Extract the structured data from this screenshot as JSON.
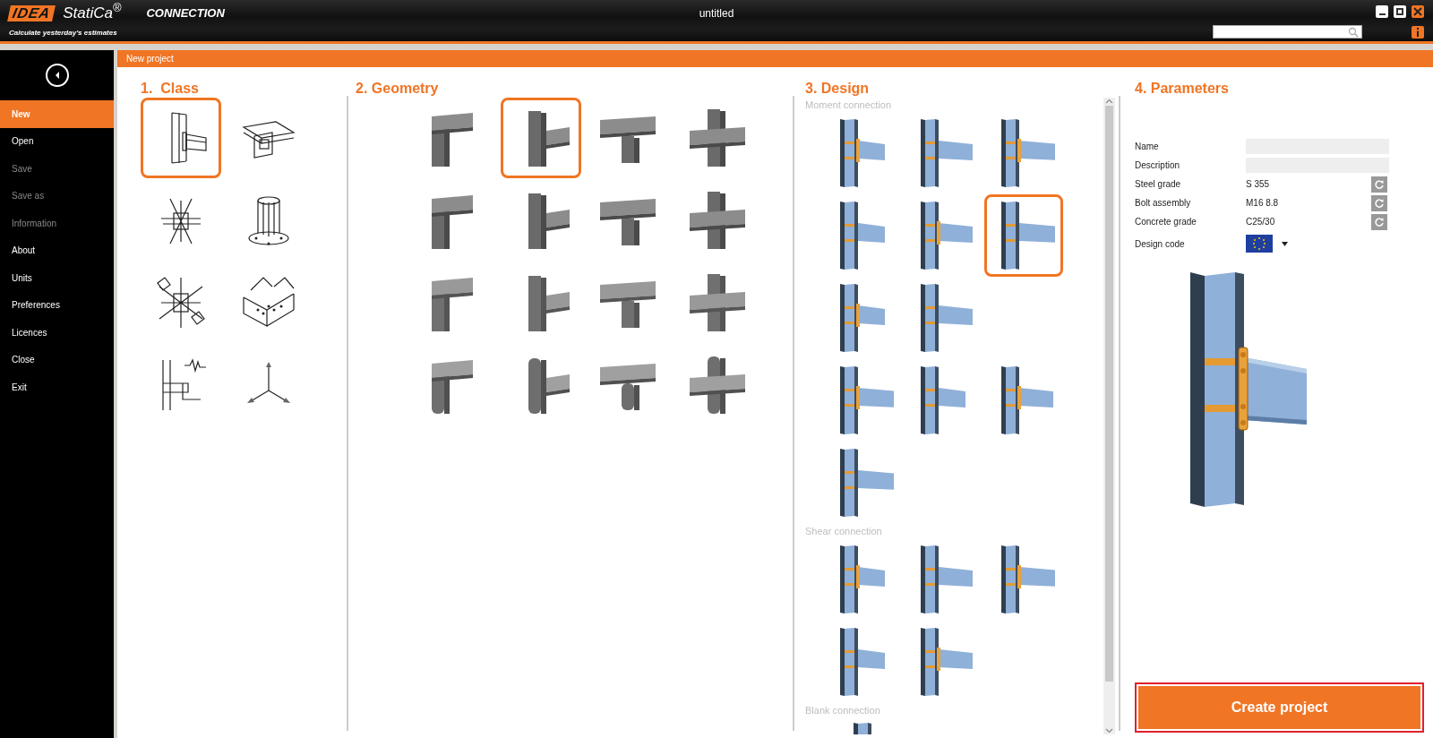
{
  "window": {
    "logo_mark": "IDEA",
    "brand": "StatiCa$^{®}$",
    "product": "CONNECTION",
    "tagline": "Calculate yesterday's estimates",
    "title": "untitled"
  },
  "sidebar": {
    "items": [
      {
        "label": "New",
        "selected": true,
        "disabled": false
      },
      {
        "label": "Open",
        "selected": false,
        "disabled": false
      },
      {
        "label": "Save",
        "selected": false,
        "disabled": true
      },
      {
        "label": "Save as",
        "selected": false,
        "disabled": true
      },
      {
        "label": "Information",
        "selected": false,
        "disabled": true
      },
      {
        "label": "About",
        "selected": false,
        "disabled": false
      },
      {
        "label": "Units",
        "selected": false,
        "disabled": false
      },
      {
        "label": "Preferences",
        "selected": false,
        "disabled": false
      },
      {
        "label": "Licences",
        "selected": false,
        "disabled": false
      },
      {
        "label": "Close",
        "selected": false,
        "disabled": false
      },
      {
        "label": "Exit",
        "selected": false,
        "disabled": false
      }
    ]
  },
  "page_title": "New project",
  "class": {
    "title": "1.  Class",
    "items": [
      {
        "kind": "beam-column",
        "selected": true
      },
      {
        "kind": "beam-beam",
        "selected": false
      },
      {
        "kind": "truss-node",
        "selected": false
      },
      {
        "kind": "anchor",
        "selected": false
      },
      {
        "kind": "multi-member",
        "selected": false
      },
      {
        "kind": "plate-node",
        "selected": false
      },
      {
        "kind": "seismic",
        "selected": false
      },
      {
        "kind": "axes",
        "selected": false
      }
    ]
  },
  "geometry": {
    "title": "2. Geometry",
    "items": [
      {
        "kind": "corner-ibeam",
        "selected": false
      },
      {
        "kind": "tee-ibeam",
        "selected": true
      },
      {
        "kind": "ridge-ibeam",
        "selected": false
      },
      {
        "kind": "cross-ibeam",
        "selected": false
      },
      {
        "kind": "corner-ibeam",
        "selected": false
      },
      {
        "kind": "tee-ibeam",
        "selected": false
      },
      {
        "kind": "ridge-ibeam",
        "selected": false
      },
      {
        "kind": "cross-ibeam",
        "selected": false
      },
      {
        "kind": "corner-box",
        "selected": false
      },
      {
        "kind": "tee-box",
        "selected": false
      },
      {
        "kind": "ridge-box",
        "selected": false
      },
      {
        "kind": "cross-box",
        "selected": false
      },
      {
        "kind": "corner-tube",
        "selected": false
      },
      {
        "kind": "tee-tube",
        "selected": false
      },
      {
        "kind": "ridge-tube",
        "selected": false
      },
      {
        "kind": "cross-tube",
        "selected": false
      }
    ]
  },
  "design": {
    "title": "3. Design",
    "sections": [
      {
        "title": "Moment connection",
        "rows": [
          {
            "items": [
              {
                "selected": false
              },
              {
                "selected": false
              },
              {
                "selected": false
              }
            ]
          },
          {
            "items": [
              {
                "selected": false
              },
              {
                "selected": false
              },
              {
                "selected": true
              }
            ]
          },
          {
            "items": [
              {
                "selected": false
              },
              {
                "selected": false
              }
            ]
          },
          {
            "items": [
              {
                "selected": false
              },
              {
                "selected": false
              },
              {
                "selected": false
              }
            ]
          },
          {
            "items": [
              {
                "selected": false
              }
            ]
          }
        ]
      },
      {
        "title": "Shear connection",
        "rows": [
          {
            "items": [
              {
                "selected": false
              },
              {
                "selected": false
              },
              {
                "selected": false
              }
            ]
          },
          {
            "items": [
              {
                "selected": false
              },
              {
                "selected": false
              }
            ]
          }
        ]
      },
      {
        "title": "Blank connection",
        "rows": [
          {
            "items": [
              {
                "kind": "blank",
                "selected": false
              }
            ]
          }
        ]
      }
    ]
  },
  "parameters": {
    "title": "4. Parameters",
    "fields": [
      {
        "kind": "input",
        "label": "Name"
      },
      {
        "kind": "input",
        "label": "Description"
      },
      {
        "kind": "value",
        "label": "Steel grade",
        "value": "S 355"
      },
      {
        "kind": "value",
        "label": "Bolt assembly",
        "value": "M16 8.8"
      },
      {
        "kind": "value",
        "label": "Concrete grade",
        "value": "C25/30"
      },
      {
        "kind": "flag",
        "label": "Design code"
      }
    ],
    "button": "Create project"
  }
}
